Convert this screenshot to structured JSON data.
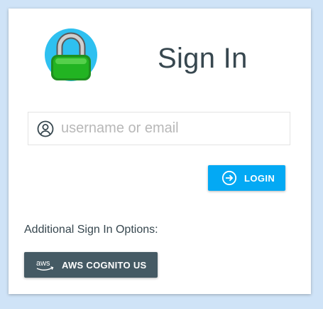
{
  "header": {
    "title": "Sign In",
    "logo_icon": "padlock-icon"
  },
  "login_form": {
    "username_placeholder": "username or email",
    "username_value": "",
    "user_icon": "user-circle-icon",
    "login_button_label": "LOGIN",
    "login_icon": "sign-in-arrow-icon"
  },
  "additional_options": {
    "label": "Additional Sign In Options:",
    "providers": [
      {
        "label": "AWS COGNITO US",
        "icon": "aws-icon",
        "icon_text": "aws"
      }
    ]
  },
  "colors": {
    "background": "#cfe3f7",
    "primary": "#03a9f4",
    "provider_button": "#455a64",
    "title_text": "#37474f"
  }
}
